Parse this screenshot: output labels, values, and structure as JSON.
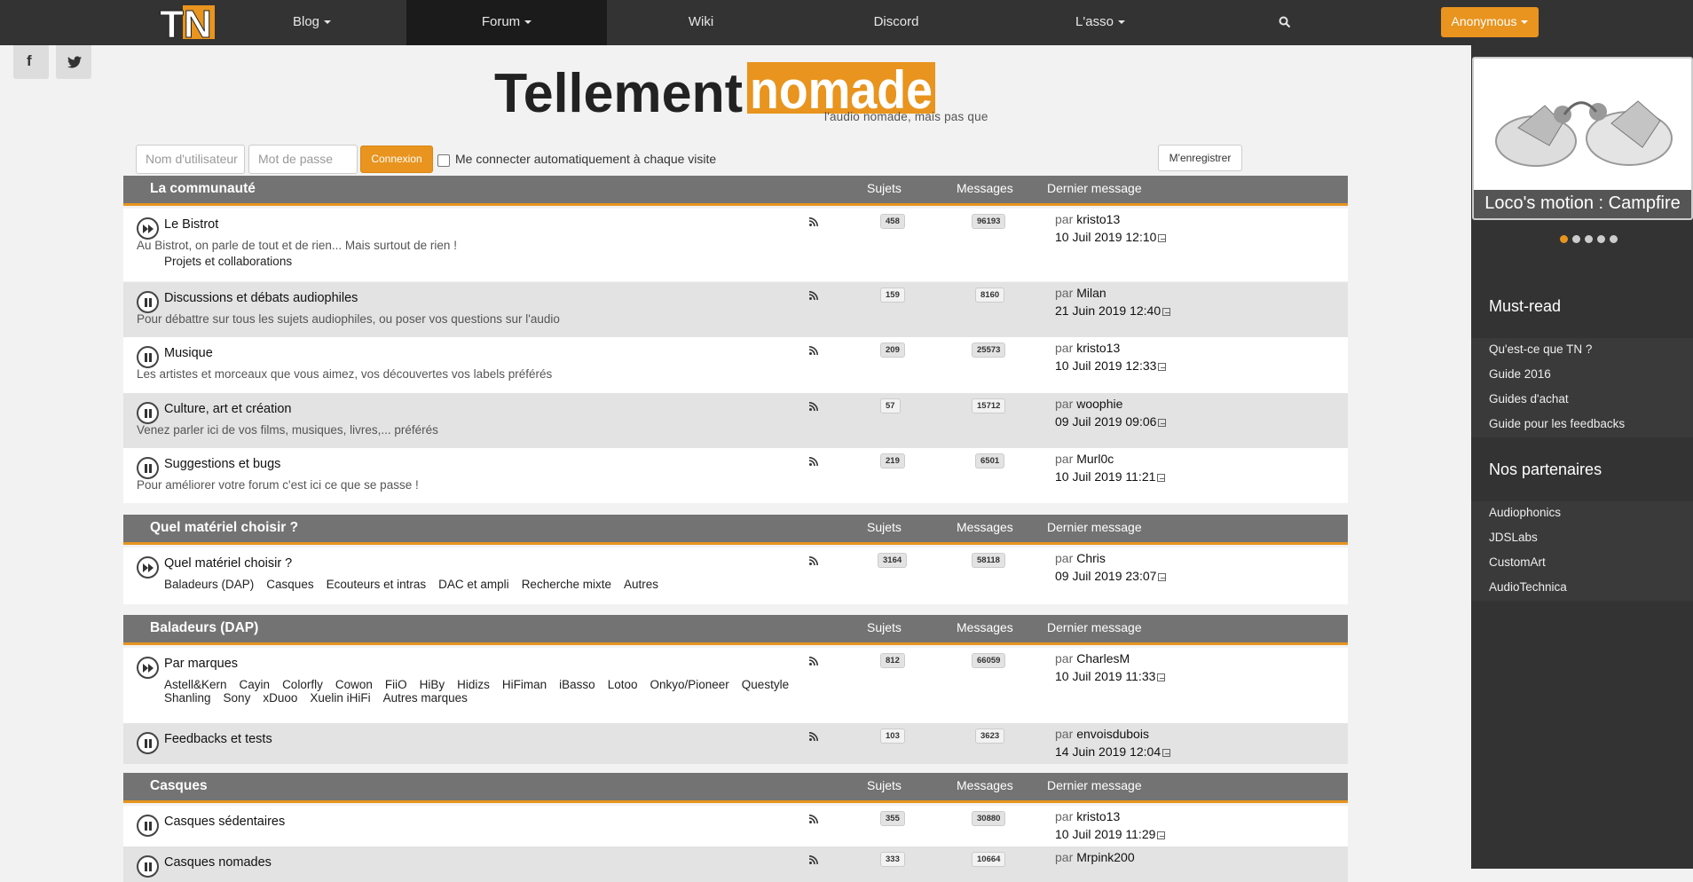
{
  "nav": {
    "brand": "TN",
    "items": [
      {
        "label": "Blog",
        "dropdown": true
      },
      {
        "label": "Forum",
        "dropdown": true,
        "active": true
      },
      {
        "label": "Wiki",
        "dropdown": false
      },
      {
        "label": "Discord",
        "dropdown": false
      },
      {
        "label": "L'asso",
        "dropdown": true
      }
    ],
    "search_icon": "search-icon",
    "user_button": "Anonymous"
  },
  "social": {
    "facebook": "f",
    "twitter": "twitter-icon"
  },
  "header": {
    "logo_word1": "Tellement",
    "logo_word2": "nomade",
    "tagline": "l'audio nomade, mais pas que"
  },
  "login": {
    "username_placeholder": "Nom d'utilisateur",
    "password_placeholder": "Mot de passe",
    "submit": "Connexion",
    "autologin": "Me connecter automatiquement à chaque visite",
    "register": "M'enregistrer"
  },
  "columns": {
    "topics": "Sujets",
    "posts": "Messages",
    "last": "Dernier message",
    "by": "par"
  },
  "categories": [
    {
      "title": "La communauté",
      "forums": [
        {
          "name": "Le Bistrot",
          "desc": "Au Bistrot, on parle de tout et de rien... Mais surtout de rien !",
          "subforums": [
            "Projets et collaborations"
          ],
          "topics": "458",
          "posts": "96193",
          "last_user": "kristo13",
          "last_date": "10 Juil 2019 12:10",
          "unread": true
        },
        {
          "name": "Discussions et débats audiophiles",
          "desc": "Pour débattre sur tous les sujets audiophiles, ou poser vos questions sur l'audio",
          "subforums": [],
          "topics": "159",
          "posts": "8160",
          "last_user": "Milan",
          "last_date": "21 Juin 2019 12:40",
          "unread": false
        },
        {
          "name": "Musique",
          "desc": "Les artistes et morceaux que vous aimez, vos découvertes vos labels préférés",
          "subforums": [],
          "topics": "209",
          "posts": "25573",
          "last_user": "kristo13",
          "last_date": "10 Juil 2019 12:33",
          "unread": false
        },
        {
          "name": "Culture, art et création",
          "desc": "Venez parler ici de vos films, musiques, livres,... préférés",
          "subforums": [],
          "topics": "57",
          "posts": "15712",
          "last_user": "woophie",
          "last_date": "09 Juil 2019 09:06",
          "unread": false
        },
        {
          "name": "Suggestions et bugs",
          "desc": "Pour améliorer votre forum c'est ici ce que se passe !",
          "subforums": [],
          "topics": "219",
          "posts": "6501",
          "last_user": "Murl0c",
          "last_date": "10 Juil 2019 11:21",
          "unread": false
        }
      ]
    },
    {
      "title": "Quel matériel choisir ?",
      "forums": [
        {
          "name": "Quel matériel choisir ?",
          "desc": "",
          "subforums": [
            "Baladeurs (DAP)",
            "Casques",
            "Ecouteurs et intras",
            "DAC et ampli",
            "Recherche mixte",
            "Autres"
          ],
          "topics": "3164",
          "posts": "58118",
          "last_user": "Chris",
          "last_date": "09 Juil 2019 23:07",
          "unread": true
        }
      ]
    },
    {
      "title": "Baladeurs (DAP)",
      "forums": [
        {
          "name": "Par marques",
          "desc": "",
          "subforums": [
            "Astell&Kern",
            "Cayin",
            "Colorfly",
            "Cowon",
            "FiiO",
            "HiBy",
            "Hidizs",
            "HiFiman",
            "iBasso",
            "Lotoo",
            "Onkyo/Pioneer",
            "Questyle",
            "Shanling",
            "Sony",
            "xDuoo",
            "Xuelin iHiFi",
            "Autres marques"
          ],
          "topics": "812",
          "posts": "66059",
          "last_user": "CharlesM",
          "last_date": "10 Juil 2019 11:33",
          "unread": true
        },
        {
          "name": "Feedbacks et tests",
          "desc": "",
          "subforums": [],
          "topics": "103",
          "posts": "3623",
          "last_user": "envoisdubois",
          "last_date": "14 Juin 2019 12:04",
          "unread": false
        }
      ]
    },
    {
      "title": "Casques",
      "forums": [
        {
          "name": "Casques sédentaires",
          "desc": "",
          "subforums": [],
          "topics": "355",
          "posts": "30880",
          "last_user": "kristo13",
          "last_date": "10 Juil 2019 11:29",
          "unread": false
        },
        {
          "name": "Casques nomades",
          "desc": "",
          "subforums": [],
          "topics": "333",
          "posts": "10664",
          "last_user": "Mrpink200",
          "last_date": "",
          "unread": false
        }
      ]
    }
  ],
  "sidebar": {
    "carousel_caption": "Loco's motion : Campfire",
    "carousel_active": 1,
    "carousel_count": 5,
    "mustread_title": "Must-read",
    "mustread": [
      "Qu'est-ce que TN ?",
      "Guide 2016",
      "Guides d'achat",
      "Guide pour les feedbacks"
    ],
    "partners_title": "Nos partenaires",
    "partners": [
      "Audiophonics",
      "JDSLabs",
      "CustomArt",
      "AudioTechnica"
    ]
  },
  "colors": {
    "accent": "#e8941e",
    "nav_bg": "#333333",
    "cat_header": "#737373",
    "row_alt": "#e3e3e3"
  }
}
